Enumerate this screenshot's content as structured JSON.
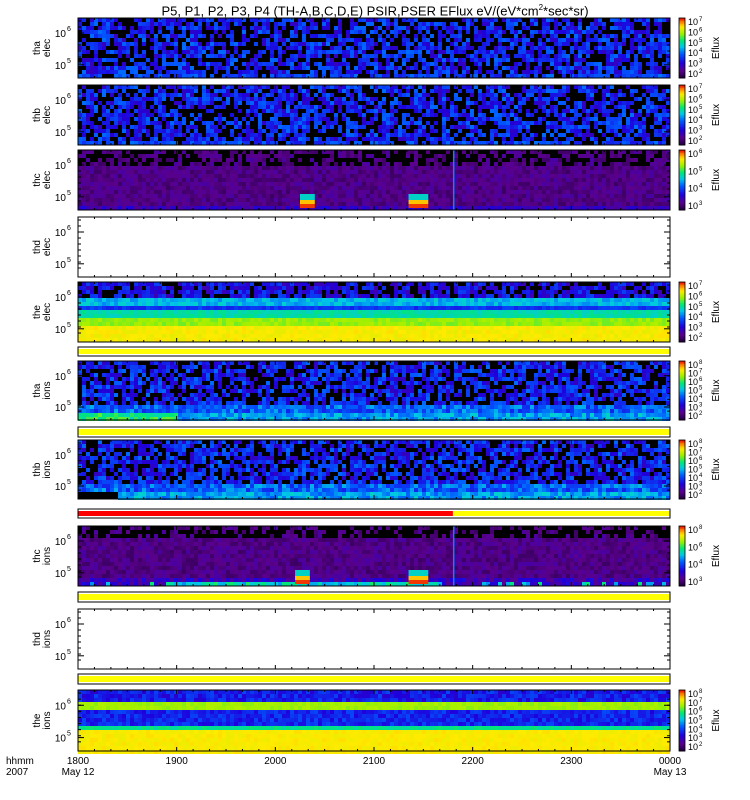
{
  "title_main": "P5, P1, P2, P3, P4 (TH-A,B,C,D,E) PSIR,PSER EFlux eV/(eV*cm",
  "title_exp": "2",
  "title_tail": "*sec*sr)",
  "time_axis": {
    "label_line1": "hhmm",
    "label_line2": "2007",
    "ticks": [
      "1800",
      "1900",
      "2000",
      "2100",
      "2200",
      "2300",
      "0000"
    ],
    "start_date": "May 12",
    "end_date": "May 13",
    "range": [
      18.0,
      24.0
    ]
  },
  "colors": {
    "bar_yellow": "#ffff00",
    "bar_red": "#ff0000",
    "background": "#000000"
  },
  "chart_data": {
    "type": "heatmap",
    "colorbar_label": "Eflux",
    "panels": [
      {
        "id": "tha_elec",
        "ylabel": [
          "tha",
          "elec"
        ],
        "yticks": [
          "10",
          "10"
        ],
        "yexp": [
          "6",
          "5"
        ],
        "cbar_exp": [
          "7",
          "6",
          "5",
          "4",
          "3",
          "2"
        ],
        "pattern": "sparse",
        "has_data": true
      },
      {
        "id": "thb_elec",
        "ylabel": [
          "thb",
          "elec"
        ],
        "yticks": [
          "10",
          "10"
        ],
        "yexp": [
          "6",
          "5"
        ],
        "cbar_exp": [
          "7",
          "6",
          "5",
          "4",
          "3",
          "2"
        ],
        "pattern": "sparse",
        "has_data": true
      },
      {
        "id": "thc_elec",
        "ylabel": [
          "thc",
          "elec"
        ],
        "yticks": [
          "10",
          "10"
        ],
        "yexp": [
          "6",
          "5"
        ],
        "cbar_exp": [
          "6",
          "5",
          "4",
          "3"
        ],
        "pattern": "purple",
        "has_data": true,
        "hot_spots": [
          [
            20.25,
            20.4
          ],
          [
            21.35,
            21.55
          ]
        ],
        "spike": 21.8
      },
      {
        "id": "thd_elec",
        "ylabel": [
          "thd",
          "elec"
        ],
        "yticks": [
          "10",
          "10"
        ],
        "yexp": [
          "6",
          "5"
        ],
        "cbar_exp": [],
        "pattern": "empty",
        "has_data": false
      },
      {
        "id": "the_elec",
        "ylabel": [
          "the",
          "elec"
        ],
        "yticks": [
          "10",
          "10"
        ],
        "yexp": [
          "6",
          "5"
        ],
        "cbar_exp": [
          "7",
          "6",
          "5",
          "4",
          "3",
          "2"
        ],
        "pattern": "banded",
        "has_data": true
      },
      {
        "id": "tha_ions",
        "ylabel": [
          "tha",
          "ions"
        ],
        "yticks": [
          "10",
          "10"
        ],
        "yexp": [
          "6",
          "5"
        ],
        "cbar_exp": [
          "8",
          "7",
          "6",
          "5",
          "4",
          "3",
          "2"
        ],
        "pattern": "ions_low",
        "has_data": true
      },
      {
        "id": "thb_ions",
        "ylabel": [
          "thb",
          "ions"
        ],
        "yticks": [
          "10",
          "10"
        ],
        "yexp": [
          "6",
          "5"
        ],
        "cbar_exp": [
          "8",
          "7",
          "6",
          "5",
          "4",
          "3",
          "2"
        ],
        "pattern": "ions_low2",
        "has_data": true
      },
      {
        "id": "thc_ions",
        "ylabel": [
          "thc",
          "ions"
        ],
        "yticks": [
          "10",
          "10"
        ],
        "yexp": [
          "6",
          "5"
        ],
        "cbar_exp": [
          "8",
          "6",
          "4",
          "3"
        ],
        "pattern": "purple_ions",
        "has_data": true,
        "hot_spots": [
          [
            20.2,
            20.35
          ],
          [
            21.35,
            21.55
          ]
        ],
        "spike": 21.8
      },
      {
        "id": "thd_ions",
        "ylabel": [
          "thd",
          "ions"
        ],
        "yticks": [
          "10",
          "10"
        ],
        "yexp": [
          "6",
          "5"
        ],
        "cbar_exp": [],
        "pattern": "empty",
        "has_data": false
      },
      {
        "id": "the_ions",
        "ylabel": [
          "the",
          "ions"
        ],
        "yticks": [
          "10",
          "10"
        ],
        "yexp": [
          "6",
          "5"
        ],
        "cbar_exp": [
          "8",
          "7",
          "6",
          "5",
          "4",
          "3",
          "2"
        ],
        "pattern": "ions_banded",
        "has_data": true
      }
    ],
    "mode_bars": [
      {
        "after": "thd_elec",
        "segments": []
      },
      {
        "after": "the_elec",
        "segments": [
          {
            "from": 18.0,
            "to": 24.0,
            "color": "yellow"
          }
        ]
      },
      {
        "after": "tha_ions",
        "segments": [
          {
            "from": 18.0,
            "to": 24.0,
            "color": "yellow"
          }
        ]
      },
      {
        "after": "thb_ions",
        "segments": [
          {
            "from": 18.0,
            "to": 21.8,
            "color": "red"
          },
          {
            "from": 21.8,
            "to": 24.0,
            "color": "yellow"
          }
        ]
      },
      {
        "after": "thc_ions",
        "segments": [
          {
            "from": 18.0,
            "to": 24.0,
            "color": "yellow"
          }
        ]
      },
      {
        "after": "thd_ions",
        "segments": [
          {
            "from": 18.0,
            "to": 24.0,
            "color": "yellow"
          }
        ]
      }
    ]
  }
}
